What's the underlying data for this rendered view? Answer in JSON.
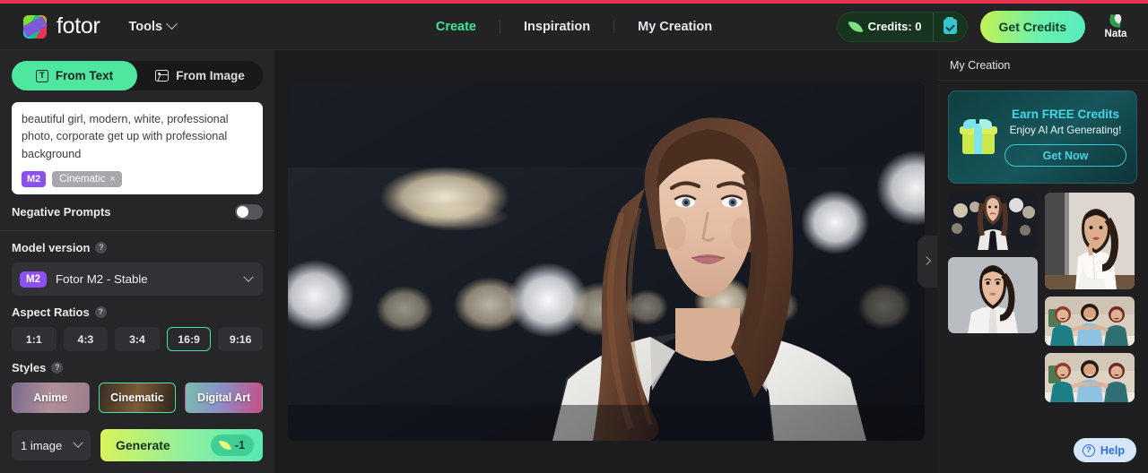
{
  "header": {
    "brand": "fotor",
    "tools_label": "Tools",
    "nav": [
      {
        "label": "Create",
        "active": true
      },
      {
        "label": "Inspiration",
        "active": false
      },
      {
        "label": "My Creation",
        "active": false
      }
    ],
    "credits_label": "Credits: 0",
    "clipboard_icon": "clipboard-check-icon",
    "get_credits_label": "Get Credits",
    "account_name": "Nata",
    "accent_green": "#3ee698",
    "top_bar_color": "#e8344e"
  },
  "left_panel": {
    "tabs": [
      {
        "label": "From Text",
        "icon": "text-box-icon",
        "active": true
      },
      {
        "label": "From Image",
        "icon": "image-icon",
        "active": false
      }
    ],
    "prompt_value": "beautiful girl, modern, white, professional photo, corporate get up with professional background",
    "prompt_tags": {
      "model_badge": "M2",
      "style_tag": "Cinematic",
      "style_remove": "×"
    },
    "negative_prompts_label": "Negative Prompts",
    "negative_prompts_on": false,
    "model_version": {
      "title": "Model version",
      "help": "?",
      "badge": "M2",
      "selected": "Fotor M2 - Stable"
    },
    "aspect_ratios": {
      "title": "Aspect Ratios",
      "help": "?",
      "options": [
        "1:1",
        "4:3",
        "3:4",
        "16:9",
        "9:16"
      ],
      "selected": "16:9"
    },
    "styles": {
      "title": "Styles",
      "help": "?",
      "options": [
        "Anime",
        "Cinematic",
        "Digital Art"
      ],
      "selected": "Cinematic"
    },
    "image_count": "1 image",
    "generate_label": "Generate",
    "generate_cost": "-1"
  },
  "canvas": {
    "image_alt": "portrait of a woman in a white blazer with dark top against a dark bokeh background",
    "collapse_panel_icon": "chevron-right-icon"
  },
  "right_panel": {
    "title": "My Creation",
    "promo": {
      "headline_pre": "Earn ",
      "headline_accent": "FREE",
      "headline_post": " Credits",
      "subtext": "Enjoy AI Art Generating!",
      "button": "Get Now",
      "icon": "gift-icon",
      "accent_color": "#45d6e8"
    },
    "thumbnails": [
      {
        "name": "thumb-woman-bokeh",
        "ratio": "wide"
      },
      {
        "name": "thumb-woman-portrait-gray",
        "ratio": "tall"
      },
      {
        "name": "thumb-woman-white-shirt",
        "ratio": "tall"
      },
      {
        "name": "thumb-three-friends-1",
        "ratio": "wide"
      },
      {
        "name": "thumb-three-friends-2",
        "ratio": "wide"
      }
    ],
    "help_label": "Help",
    "help_icon": "question-circle-icon"
  }
}
